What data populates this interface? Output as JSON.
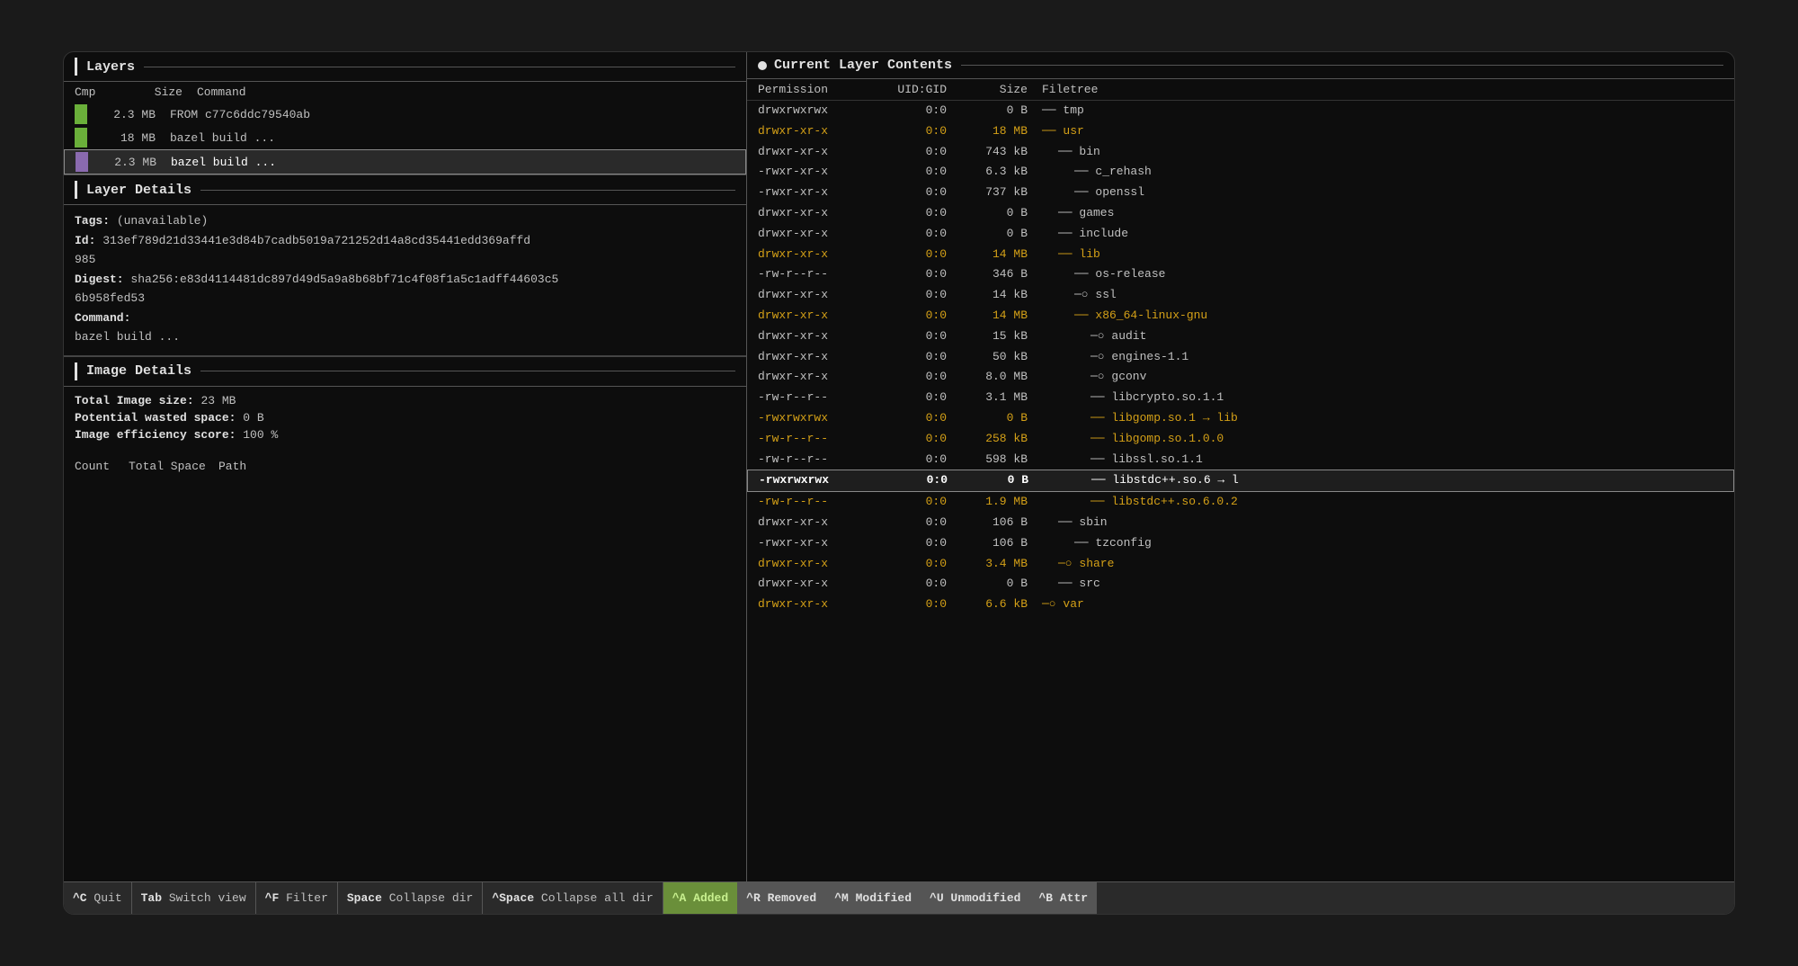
{
  "left_panel": {
    "layers_title": "Layers",
    "col_headers": {
      "cmp": "Cmp",
      "size": "Size",
      "command": "Command"
    },
    "layers": [
      {
        "color": "#6aaf3a",
        "size": "2.3 MB",
        "command": "FROM c77c6ddc79540ab",
        "selected": false
      },
      {
        "color": "#6aaf3a",
        "size": "18 MB",
        "command": "bazel build ...",
        "selected": false
      },
      {
        "color": "#8a6aaf",
        "size": "2.3 MB",
        "command": "bazel build ...",
        "selected": true
      }
    ],
    "layer_details_title": "Layer Details",
    "layer_details": {
      "tags_label": "Tags:",
      "tags_value": "(unavailable)",
      "id_label": "Id:",
      "id_value": "313ef789d21d33441e3d84b7cadb5019a721252d14a8cd35441edd369affd",
      "id_number": "985",
      "digest_label": "Digest:",
      "digest_value": "sha256:e83d4114481dc897d49d5a9a8b68bf71c4f08f1a5c1adff44603c5",
      "digest_suffix": "6b958fed53",
      "command_label": "Command:",
      "command_value": "bazel build ..."
    },
    "image_details_title": "Image Details",
    "image_details": {
      "total_size_label": "Total Image size:",
      "total_size_value": "23 MB",
      "wasted_label": "Potential wasted space:",
      "wasted_value": "0 B",
      "efficiency_label": "Image efficiency score:",
      "efficiency_value": "100 %"
    },
    "wasted_table": {
      "count_label": "Count",
      "space_label": "Total Space",
      "path_label": "Path"
    }
  },
  "right_panel": {
    "header_title": "Current Layer Contents",
    "col_headers": {
      "permission": "Permission",
      "uid_gid": "UID:GID",
      "size": "Size",
      "filetree": "Filetree"
    },
    "files": [
      {
        "perm": "drwxrwxrwx",
        "uid": "0:0",
        "size": "0 B",
        "tree": "── tmp",
        "indent": 0,
        "style": "normal"
      },
      {
        "perm": "drwxr-xr-x",
        "uid": "0:0",
        "size": "18 MB",
        "tree": "── usr",
        "indent": 0,
        "style": "yellow"
      },
      {
        "perm": "drwxr-xr-x",
        "uid": "0:0",
        "size": "743 kB",
        "tree": "── bin",
        "indent": 1,
        "style": "normal"
      },
      {
        "perm": "-rwxr-xr-x",
        "uid": "0:0",
        "size": "6.3 kB",
        "tree": "── c_rehash",
        "indent": 2,
        "style": "normal"
      },
      {
        "perm": "-rwxr-xr-x",
        "uid": "0:0",
        "size": "737 kB",
        "tree": "── openssl",
        "indent": 2,
        "style": "normal"
      },
      {
        "perm": "drwxr-xr-x",
        "uid": "0:0",
        "size": "0 B",
        "tree": "── games",
        "indent": 1,
        "style": "normal"
      },
      {
        "perm": "drwxr-xr-x",
        "uid": "0:0",
        "size": "0 B",
        "tree": "── include",
        "indent": 1,
        "style": "normal"
      },
      {
        "perm": "drwxr-xr-x",
        "uid": "0:0",
        "size": "14 MB",
        "tree": "── lib",
        "indent": 1,
        "style": "yellow"
      },
      {
        "perm": "-rw-r--r--",
        "uid": "0:0",
        "size": "346 B",
        "tree": "── os-release",
        "indent": 2,
        "style": "normal"
      },
      {
        "perm": "drwxr-xr-x",
        "uid": "0:0",
        "size": "14 kB",
        "tree": "─○ ssl",
        "indent": 2,
        "style": "normal"
      },
      {
        "perm": "drwxr-xr-x",
        "uid": "0:0",
        "size": "14 MB",
        "tree": "── x86_64-linux-gnu",
        "indent": 2,
        "style": "yellow"
      },
      {
        "perm": "drwxr-xr-x",
        "uid": "0:0",
        "size": "15 kB",
        "tree": "─○ audit",
        "indent": 3,
        "style": "normal"
      },
      {
        "perm": "drwxr-xr-x",
        "uid": "0:0",
        "size": "50 kB",
        "tree": "─○ engines-1.1",
        "indent": 3,
        "style": "normal"
      },
      {
        "perm": "drwxr-xr-x",
        "uid": "0:0",
        "size": "8.0 MB",
        "tree": "─○ gconv",
        "indent": 3,
        "style": "normal"
      },
      {
        "perm": "-rw-r--r--",
        "uid": "0:0",
        "size": "3.1 MB",
        "tree": "── libcrypto.so.1.1",
        "indent": 3,
        "style": "normal"
      },
      {
        "perm": "-rwxrwxrwx",
        "uid": "0:0",
        "size": "0 B",
        "tree": "── libgomp.so.1 → lib",
        "indent": 3,
        "style": "yellow"
      },
      {
        "perm": "-rw-r--r--",
        "uid": "0:0",
        "size": "258 kB",
        "tree": "── libgomp.so.1.0.0",
        "indent": 3,
        "style": "yellow"
      },
      {
        "perm": "-rw-r--r--",
        "uid": "0:0",
        "size": "598 kB",
        "tree": "── libssl.so.1.1",
        "indent": 3,
        "style": "normal"
      },
      {
        "perm": "-rwxrwxrwx",
        "uid": "0:0",
        "size": "0 B",
        "tree": "── libstdc++.so.6 → l",
        "indent": 3,
        "style": "highlighted"
      },
      {
        "perm": "-rw-r--r--",
        "uid": "0:0",
        "size": "1.9 MB",
        "tree": "── libstdc++.so.6.0.2",
        "indent": 3,
        "style": "yellow"
      },
      {
        "perm": "drwxr-xr-x",
        "uid": "0:0",
        "size": "106 B",
        "tree": "── sbin",
        "indent": 1,
        "style": "normal"
      },
      {
        "perm": "-rwxr-xr-x",
        "uid": "0:0",
        "size": "106 B",
        "tree": "── tzconfig",
        "indent": 2,
        "style": "normal"
      },
      {
        "perm": "drwxr-xr-x",
        "uid": "0:0",
        "size": "3.4 MB",
        "tree": "─○ share",
        "indent": 1,
        "style": "yellow"
      },
      {
        "perm": "drwxr-xr-x",
        "uid": "0:0",
        "size": "0 B",
        "tree": "── src",
        "indent": 1,
        "style": "normal"
      },
      {
        "perm": "drwxr-xr-x",
        "uid": "0:0",
        "size": "6.6 kB",
        "tree": "─○ var",
        "indent": 0,
        "style": "yellow"
      }
    ]
  },
  "status_bar": {
    "quit": "^C Quit",
    "switch_view": "Tab Switch view",
    "filter": "^F Filter",
    "collapse_dir": "Space Collapse dir",
    "collapse_all": "^Space Collapse all dir",
    "added": "^A Added",
    "removed": "^R Removed",
    "modified": "^M Modified",
    "unmodified": "^U Unmodified",
    "attr": "^B Attr"
  }
}
